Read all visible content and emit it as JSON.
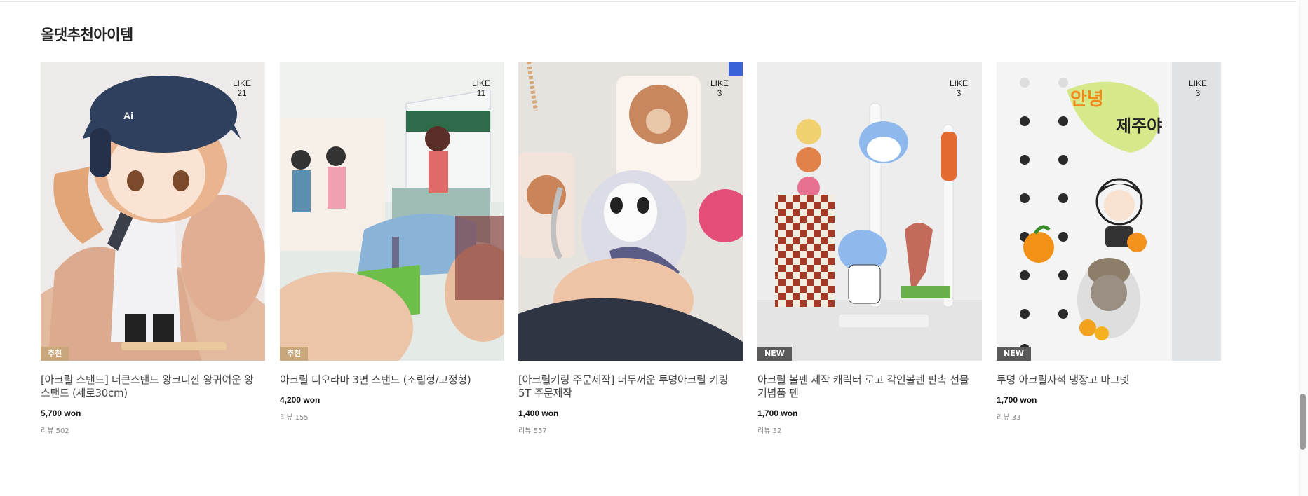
{
  "section": {
    "title": "올댓추천아이템"
  },
  "like_label": "LIKE",
  "products": [
    {
      "name": "[아크릴 스탠드] 더큰스탠드 왕크니깐 왕귀여운 왕 스탠드 (세로30cm)",
      "price": "5,700 won",
      "review": "리뷰 502",
      "likes": "21",
      "badge": "추천"
    },
    {
      "name": "아크릴 디오라마 3면 스탠드 (조립형/고정형)",
      "price": "4,200 won",
      "review": "리뷰 155",
      "likes": "11",
      "badge": "추천"
    },
    {
      "name": "[아크릴키링 주문제작] 더두꺼운 투명아크릴 키링 5T 주문제작",
      "price": "1,400 won",
      "review": "리뷰 557",
      "likes": "3",
      "badge": ""
    },
    {
      "name": "아크릴 볼펜 제작 캐릭터 로고 각인볼펜 판촉 선물 기념품 펜",
      "price": "1,700 won",
      "review": "리뷰 32",
      "likes": "3",
      "badge": "NEW"
    },
    {
      "name": "투명 아크릴자석 냉장고 마그넷",
      "price": "1,700 won",
      "review": "리뷰 33",
      "likes": "3",
      "badge": "NEW"
    }
  ],
  "colors": {
    "badge_recommend": "#c9a77a",
    "badge_new": "#5a5a5a"
  }
}
